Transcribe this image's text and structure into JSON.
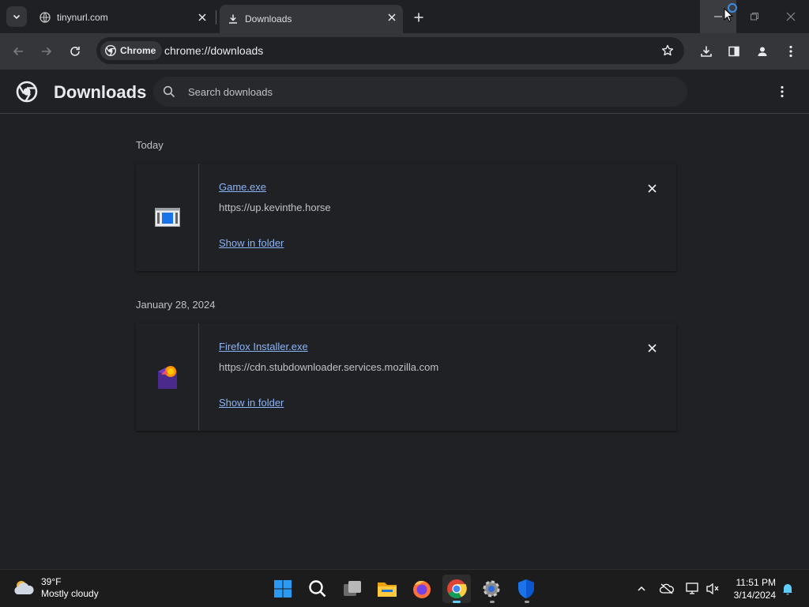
{
  "tabs": [
    {
      "title": "tinynurl.com",
      "active": false
    },
    {
      "title": "Downloads",
      "active": true
    }
  ],
  "toolbar": {
    "chip_label": "Chrome",
    "url": "chrome://downloads"
  },
  "downloads_page": {
    "title": "Downloads",
    "search_placeholder": "Search downloads",
    "groups": [
      {
        "date": "Today",
        "items": [
          {
            "filename": "Game.exe",
            "url": "https://up.kevinthe.horse",
            "action": "Show in folder",
            "icon": "exe-window-icon"
          }
        ]
      },
      {
        "date": "January 28, 2024",
        "items": [
          {
            "filename": "Firefox Installer.exe",
            "url": "https://cdn.stubdownloader.services.mozilla.com",
            "action": "Show in folder",
            "icon": "firefox-installer-icon"
          }
        ]
      }
    ]
  },
  "taskbar": {
    "weather_temp": "39°F",
    "weather_desc": "Mostly cloudy",
    "time": "11:51 PM",
    "date": "3/14/2024",
    "apps": [
      "start",
      "search",
      "task-view",
      "file-explorer",
      "firefox",
      "chrome",
      "settings",
      "defender"
    ],
    "active_app": "chrome"
  },
  "colors": {
    "link": "#8ab4f8",
    "background": "#202124",
    "toolbar": "#35363a"
  }
}
